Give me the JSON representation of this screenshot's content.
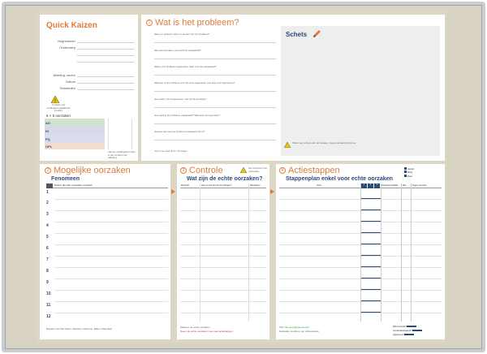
{
  "panel1": {
    "title": "Quick Kaizen",
    "fields": [
      "Volgnummer",
      "Onderwerp",
      "Afdeling, sector",
      "Datum",
      "Teamleden"
    ],
    "warning_note": "Contact met meldingsmogelijkheid invullen",
    "five_by_five": "5 × 5 oorzaken",
    "bands": [
      {
        "code": "AO",
        "color": "#cfe3cf"
      },
      {
        "code": "IO",
        "color": "#d7d8e8"
      },
      {
        "code": "PQ",
        "color": "#dcdcec"
      },
      {
        "code": "OPL",
        "color": "#f4dccd"
      }
    ],
    "footnote": "Interne meldingsformulier is het contact met afdeling"
  },
  "panel2": {
    "num": "1",
    "title": "Wat is het probleem?",
    "questions": [
      "Wat is er gebeurd, wat is er de kern van het probleem?",
      "Wie was betrokken, wie heeft het vastgesteld?",
      "Waar is het probleem opgetreden, waar voor het vastgesteld?",
      "Wanneer is het probleem voor het eerst opgetreden, hoe lang voor rapporteren?",
      "Hoe vaak is dit voorgekomen, wat zijn de gevolgen?",
      "Hoe heeft je het probleem vastgesteld? Wat heeft men gemeten?",
      "Hoeveel wat over het probleem (uitslagen) zijn er?"
    ],
    "bottom_note": "Vul in voor heel de 5 × W vragen"
  },
  "sketch": {
    "title": "Schets",
    "note": "Teken een schets van de situatie, voeg eventueel foto's toe"
  },
  "panel3": {
    "num": "2",
    "title": "Mogelijke oorzaken",
    "subtitle": "Fenomeen",
    "col_header": "Noteer hier alle mogelijke oorzaken",
    "rows": [
      "1",
      "2",
      "3",
      "4",
      "5",
      "6",
      "7",
      "8",
      "9",
      "10",
      "11",
      "12"
    ],
    "footnote": "Bepaal in de 5M: Mens, Machine, Methode, Milieu, Materiaal"
  },
  "panel4": {
    "num": "3",
    "title": "Controle",
    "subtitle": "Wat zijn de echte oorzaken?",
    "cols": [
      "Methode",
      "Hoe en wat zijn de bevindingen?",
      "Resultaten"
    ],
    "warning_label": "Zie controle in de methoden",
    "footnote": "Markeer de echte oorzaken",
    "footnote_red": "Neem de echte oorzaken mee naar actiestappen"
  },
  "panel5": {
    "num": "4",
    "title": "Actiestappen",
    "subtitle": "Stappenplan enkel voor echte oorzaken",
    "cols": [
      "Actie",
      "1",
      "2",
      "3",
      "Verantwoordelijke",
      "Wie",
      "Tegen wanneer",
      "Opvolging"
    ],
    "legend": [
      "Gestart",
      "Bezig",
      "Klaar"
    ],
    "footnote": "Plan het opvolgingsmoment",
    "footnote2": "Evaluatie na afloop van actiestappen",
    "summary": [
      "Effect bereikt?",
      "Gestandaardiseerd?",
      "Afgesloten?"
    ]
  }
}
